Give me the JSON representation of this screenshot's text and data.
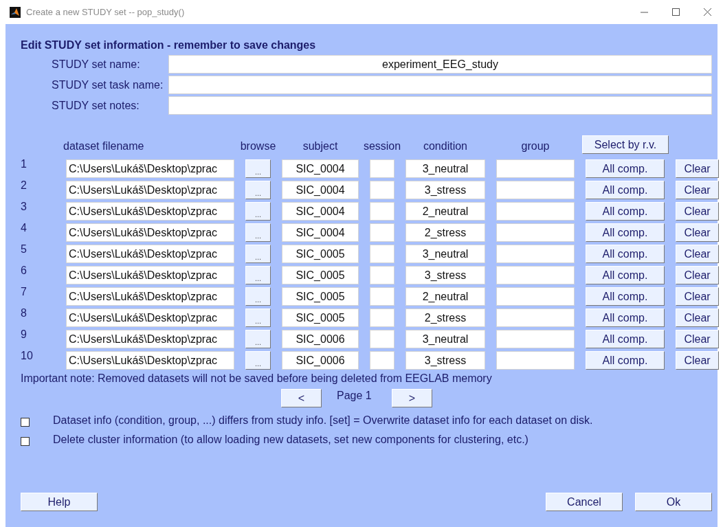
{
  "window": {
    "title": "Create a new STUDY set -- pop_study()"
  },
  "heading": "Edit STUDY set information - remember to save changes",
  "study_fields": [
    {
      "label": "STUDY set name:",
      "value": "experiment_EEG_study"
    },
    {
      "label": "STUDY set task name:"
    },
    {
      "label": "STUDY set notes:"
    }
  ],
  "table": {
    "columns": [
      "dataset filename",
      "browse",
      "subject",
      "session",
      "condition",
      "group"
    ],
    "select_button": "Select by r.v.",
    "rows": [
      {
        "number": "1",
        "filename": "C:\\Users\\Lukáš\\Desktop\\zprac",
        "browse": "...",
        "subject": "SIC_0004",
        "condition": "3_neutral",
        "components": "All comp.",
        "clear": "Clear"
      },
      {
        "number": "2",
        "filename": "C:\\Users\\Lukáš\\Desktop\\zprac",
        "browse": "...",
        "subject": "SIC_0004",
        "condition": "3_stress",
        "components": "All comp.",
        "clear": "Clear"
      },
      {
        "number": "3",
        "filename": "C:\\Users\\Lukáš\\Desktop\\zprac",
        "browse": "...",
        "subject": "SIC_0004",
        "condition": "2_neutral",
        "components": "All comp.",
        "clear": "Clear"
      },
      {
        "number": "4",
        "filename": "C:\\Users\\Lukáš\\Desktop\\zprac",
        "browse": "...",
        "subject": "SIC_0004",
        "condition": "2_stress",
        "components": "All comp.",
        "clear": "Clear"
      },
      {
        "number": "5",
        "filename": "C:\\Users\\Lukáš\\Desktop\\zprac",
        "browse": "...",
        "subject": "SIC_0005",
        "condition": "3_neutral",
        "components": "All comp.",
        "clear": "Clear"
      },
      {
        "number": "6",
        "filename": "C:\\Users\\Lukáš\\Desktop\\zprac",
        "browse": "...",
        "subject": "SIC_0005",
        "condition": "3_stress",
        "components": "All comp.",
        "clear": "Clear"
      },
      {
        "number": "7",
        "filename": "C:\\Users\\Lukáš\\Desktop\\zprac",
        "browse": "...",
        "subject": "SIC_0005",
        "condition": "2_neutral",
        "components": "All comp.",
        "clear": "Clear"
      },
      {
        "number": "8",
        "filename": "C:\\Users\\Lukáš\\Desktop\\zprac",
        "browse": "...",
        "subject": "SIC_0005",
        "condition": "2_stress",
        "components": "All comp.",
        "clear": "Clear"
      },
      {
        "number": "9",
        "filename": "C:\\Users\\Lukáš\\Desktop\\zprac",
        "browse": "...",
        "subject": "SIC_0006",
        "condition": "3_neutral",
        "components": "All comp.",
        "clear": "Clear"
      },
      {
        "number": "10",
        "filename": "C:\\Users\\Lukáš\\Desktop\\zprac",
        "browse": "...",
        "subject": "SIC_0006",
        "condition": "3_stress",
        "components": "All comp.",
        "clear": "Clear"
      }
    ]
  },
  "note": "Important note: Removed datasets will not be saved before being deleted from EEGLAB memory",
  "pager": {
    "prev": "<",
    "label": "Page 1",
    "next": ">"
  },
  "options": [
    {
      "label": "Dataset info (condition, group, ...) differs from study info. [set] = Overwrite dataset info for each dataset on disk.",
      "checked": false
    },
    {
      "label": "Delete cluster information (to allow loading new datasets, set new components for clustering, etc.)",
      "checked": false
    }
  ],
  "buttons": {
    "help": "Help",
    "cancel": "Cancel",
    "ok": "Ok"
  }
}
